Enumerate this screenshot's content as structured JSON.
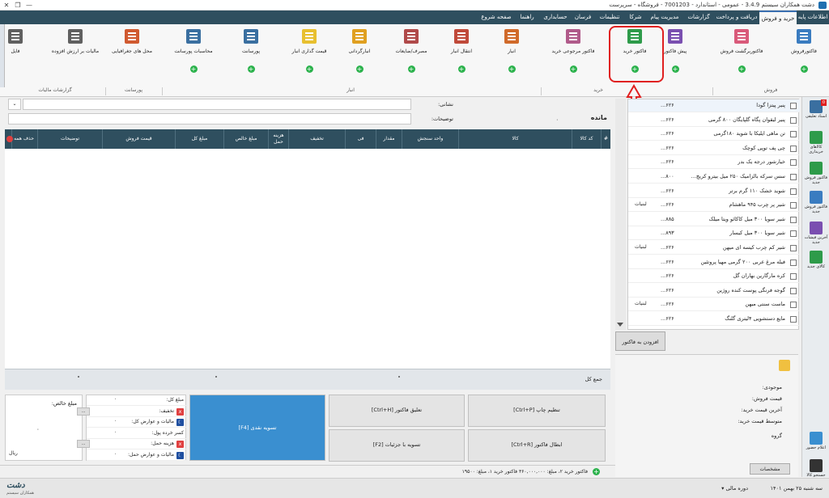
{
  "window": {
    "title": "دشت همکاران سیستم 3.4.9 - عمومی - استاندارد - 7001203 - فروشگاه - سرپرست"
  },
  "menu": [
    "اطلاعات پایه",
    "خرید و فروش",
    "دریافت و پرداخت",
    "گزارشات",
    "مدیریت پیام",
    "شرکا",
    "تنظیمات",
    "فرسان",
    "حسابداری",
    "راهنما",
    "صفحه شروع"
  ],
  "ribbon": {
    "buttons": [
      {
        "label": "فاکتورفروش",
        "color": "#3a7cc0"
      },
      {
        "label": "فاکتوربرگشت فروش",
        "color": "#d95a7a"
      },
      {
        "label": "پیش فاکتور",
        "color": "#7a4fb0"
      },
      {
        "label": "فاکتور خرید",
        "color": "#2e9b4a"
      },
      {
        "label": "فاکتور مرجوعی خرید",
        "color": "#b05a8a"
      },
      {
        "label": "انبار",
        "color": "#d06a2a"
      },
      {
        "label": "انتقال انبار",
        "color": "#c04a3a"
      },
      {
        "label": "مصرف/ضایعات",
        "color": "#b04a4a"
      },
      {
        "label": "انبارگردانی",
        "color": "#e0a020"
      },
      {
        "label": "قیمت گذاری انبار",
        "color": "#e8c030"
      },
      {
        "label": "پورسانت",
        "color": "#3a6fa0"
      },
      {
        "label": "محاسبات پورسانت",
        "color": "#3a6fa0"
      },
      {
        "label": "محل های جغرافیایی",
        "color": "#d05a30"
      },
      {
        "label": "مالیات بر ارزش افزوده",
        "color": "#606060"
      },
      {
        "label": "فایل",
        "color": "#606060"
      }
    ],
    "groups": [
      "فروش",
      "خرید",
      "انبار",
      "پورسانت",
      "گزارشات مالیات"
    ]
  },
  "form": {
    "address_label": "نشانی:",
    "desc_label": "توضیحات:",
    "balance_label": "مانده"
  },
  "grid": {
    "headers": [
      "#",
      "کد کالا",
      "کالا",
      "واحد سنجش",
      "مقدار",
      "فی",
      "تخفیف",
      "هزینه حمل",
      "مبلغ خالص",
      "مبلغ کل",
      "قیمت فروش",
      "توضیحات",
      "حذف همه"
    ]
  },
  "summary": {
    "total_label": "جمع کل",
    "net_label": "مبلغ خالص:",
    "net_value": "۰",
    "rows": [
      {
        "label": "مبلغ کل:",
        "value": "۰"
      },
      {
        "label": "تخفیف:",
        "value": "..."
      },
      {
        "label": "مالیات و عوارض کل:",
        "value": "۰"
      },
      {
        "label": "کسر خرده پول:",
        "value": "۰"
      },
      {
        "label": "هزینه حمل:",
        "value": "..."
      },
      {
        "label": "مالیات و عوارض حمل:",
        "value": "۰"
      }
    ],
    "rial": "ریال"
  },
  "actions": {
    "print": "تنظیم چاپ [Ctrl+P]",
    "suspend": "تعلیق فاکتور [Ctrl+H]",
    "cancel": "ابطال فاکتور [Ctrl+R]",
    "settle_detail": "تسویه با جزئیات [F2]",
    "settle_cash": "تسویه نقدی [F4]"
  },
  "status": {
    "text": "فاکتور خرید ۲، مبلغ: ۳۶۰,۰۰۰,۰۰۰    فاکتور خرید ۱، مبلغ: ۱۹۵۰۰"
  },
  "products": [
    {
      "name": "پنیر پیتزا گودا",
      "code": "...۶۲۶",
      "unit": ""
    },
    {
      "name": "پنیر لیقوان پگاه گلپایگان ۸۰۰ گرمی",
      "code": "...۶۲۶",
      "unit": ""
    },
    {
      "name": "تن ماهی ایلیکا با شوید ۱۸۰گرمی",
      "code": "...۶۲۶",
      "unit": ""
    },
    {
      "name": "چی پف توپی کوچک",
      "code": "...۶۲۶",
      "unit": ""
    },
    {
      "name": "خیارشور درجه یک بدر",
      "code": "...۶۲۶",
      "unit": ""
    },
    {
      "name": "سس سرکه بالزامیک ۲۵۰ میل بیترو کریچ...",
      "code": "...۸۰۰",
      "unit": ""
    },
    {
      "name": "شوید خشک ۱۱۰ گرم برتر",
      "code": "...۶۲۶",
      "unit": ""
    },
    {
      "name": "شیر پر چرب ۹۴۵ ماهشام",
      "code": "...۶۲۶",
      "unit": "لبنیات"
    },
    {
      "name": "شیر سویا ۳۰۰ میل کاکائو ویتا میلک",
      "code": "...۸۸۵",
      "unit": ""
    },
    {
      "name": "شیر سویا ۳۰۰ میل کیسار",
      "code": "...۸۹۳",
      "unit": ""
    },
    {
      "name": "شیر کم چرب کیسه ای میهن",
      "code": "...۶۲۶",
      "unit": "لبنیات"
    },
    {
      "name": "فیله مرغ عربی ۲۰۰ گرمی مهیا پروتئین",
      "code": "...۶۲۶",
      "unit": ""
    },
    {
      "name": "کره مارگارین بهاران گل",
      "code": "...۶۲۶",
      "unit": ""
    },
    {
      "name": "گوجه فرنگی پوست کنده روژین",
      "code": "...۶۲۶",
      "unit": ""
    },
    {
      "name": "ماست سنتی میهن",
      "code": "...۶۲۶",
      "unit": "لبنیات"
    },
    {
      "name": "مایع دستشویی ۴لیتری گلنگ",
      "code": "...۶۲۶",
      "unit": ""
    }
  ],
  "add_to_invoice": "افزودن به فاکتور",
  "info": {
    "stock": "موجودی:",
    "sale_price": "قیمت فروش:",
    "last_buy": "آخرین قیمت خرید:",
    "avg_buy": "متوسط قیمت خرید:",
    "group": "گروه",
    "details_btn": "مشخصات"
  },
  "sidebar": [
    {
      "label": "اسناد تعلیقی",
      "badge": "0"
    },
    {
      "label": "کالاهای خریداری",
      "badge": ""
    },
    {
      "label": "فاکتور فروش جدید",
      "badge": ""
    },
    {
      "label": "فاکتور فروش جدید",
      "badge": ""
    },
    {
      "label": "آخرین فیشات جدید",
      "badge": ""
    },
    {
      "label": "کالای جدید",
      "badge": ""
    },
    {
      "label": "اعلام حضور",
      "badge": ""
    },
    {
      "label": "جستجو کالا",
      "badge": ""
    }
  ],
  "footer": {
    "logo": "دشت",
    "logo_sub": "همکاران سیستم",
    "period": "دوره مالی",
    "date": "سه شنبه ۲۵ بهمن ۱۴۰۱"
  }
}
